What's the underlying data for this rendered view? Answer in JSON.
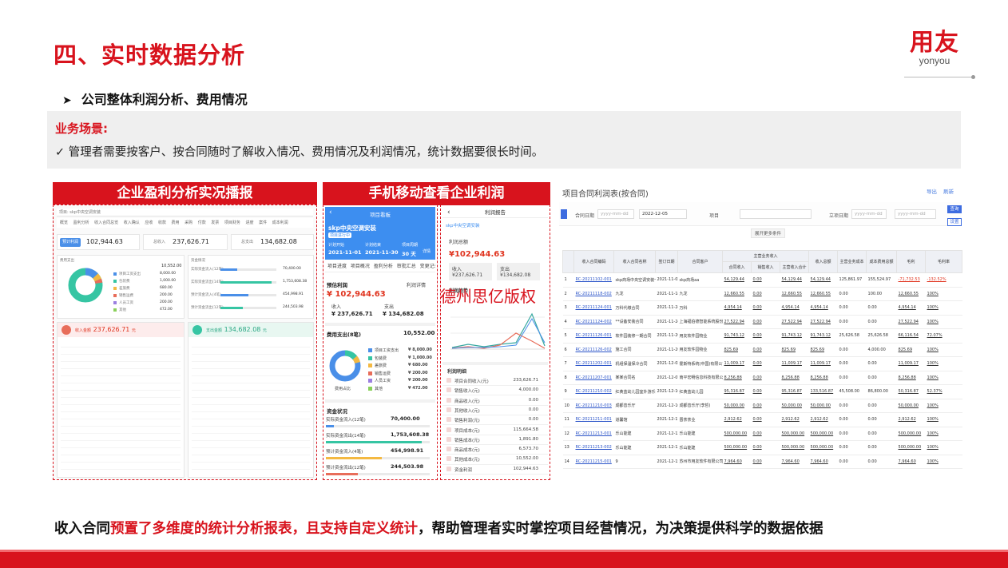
{
  "page": {
    "title": "四、实时数据分析",
    "subtitle": "公司整体利润分析、费用情况",
    "subtitle_bullet": "➤"
  },
  "logo": {
    "cn": "用友",
    "en": "yonyou"
  },
  "scenario": {
    "title": "业务场景:",
    "text": "✓ 管理者需要按客户、按合同随时了解收入情况、费用情况及利润情况，统计数据要很长时间。"
  },
  "panels": {
    "desktop_title": "企业盈利分析实况播报",
    "mobile_title": "手机移动查看企业利润"
  },
  "desktop": {
    "tab_text": "项目: skp中央空调安装",
    "nav_text": "概览 盈利分析 收入合同总览 收入确认 应收 收款 费用 采购 付款 发票 项目财务 进度 案件 成本利润",
    "profit_label": "预计利润",
    "profit_value": "102,944.63",
    "income_label": "总收入",
    "income_value": "237,626.71",
    "expense_label": "总支出",
    "expense_value": "134,682.08",
    "cost_card_title": "费用支出",
    "cost_total": "10,552.00",
    "cost_items": [
      {
        "name": "项目工资支出",
        "value": "8,000.00",
        "color": "#4a8fe8"
      },
      {
        "name": "包装费",
        "value": "1,000.00",
        "color": "#36c5a3"
      },
      {
        "name": "差旅费",
        "value": "680.00",
        "color": "#f4b942"
      },
      {
        "name": "销售运费",
        "value": "200.00",
        "color": "#e86d5a"
      },
      {
        "name": "人员工资",
        "value": "200.00",
        "color": "#9b7fe0"
      },
      {
        "name": "其他",
        "value": "472.00",
        "color": "#8ad05b"
      }
    ],
    "cash_card_title": "资金情况",
    "cash_items": [
      {
        "name": "实际资金流入(12笔)",
        "value": "70,400.00",
        "pct": 0.3,
        "color": "#4a8fe8"
      },
      {
        "name": "实际资金流出(14笔)",
        "value": "1,753,608.38",
        "pct": 0.92,
        "color": "#36c5a3"
      },
      {
        "name": "预计资金流入(4笔)",
        "value": "454,998.91",
        "pct": 0.5,
        "color": "#4a8fe8"
      },
      {
        "name": "预计资金流出(12笔)",
        "value": "244,503.98",
        "pct": 0.4,
        "color": "#36c5a3"
      }
    ],
    "income_card_label": "收入金额",
    "income_card_value": "237,626.71",
    "income_card_unit": "元",
    "expense_card_label": "支出金额",
    "expense_card_value": "134,682.08",
    "expense_card_unit": "元"
  },
  "mobile1": {
    "header": "项目看板",
    "project": "skp中央空调安装",
    "tag": "项目进行中",
    "plan_start_label": "计划开始",
    "plan_start": "2021-11-01",
    "plan_end_label": "计划结束",
    "plan_end": "2021-11-30",
    "cycle_label": "项目周期",
    "cycle": "30 天",
    "detail": "详情",
    "tabs": "项目进度 项目概况 盈利分析 审批汇总 变更记录",
    "profit_title": "预估利润",
    "profit_link": "利润详情",
    "profit": "¥ 102,944.63",
    "income_label": "收入",
    "income": "¥ 237,626.71",
    "expense_label": "支出",
    "expense": "¥ 134,682.08",
    "cost_title": "费用支出(8笔)",
    "cost_total": "10,552.00",
    "donut_center": "费用占比",
    "cost_items": [
      {
        "name": "项目工资支出",
        "value": "¥ 8,000.00",
        "color": "#4a8fe8"
      },
      {
        "name": "包装费",
        "value": "¥ 1,000.00",
        "color": "#36c5a3"
      },
      {
        "name": "差旅费",
        "value": "¥ 680.00",
        "color": "#f4b942"
      },
      {
        "name": "销售运费",
        "value": "¥ 200.00",
        "color": "#e86d5a"
      },
      {
        "name": "人员工资",
        "value": "¥ 200.00",
        "color": "#9b7fe0"
      },
      {
        "name": "其他",
        "value": "¥ 472.00",
        "color": "#8ad05b"
      }
    ],
    "cash_title": "资金状况",
    "cash_items": [
      {
        "name": "实际资金流入(12笔)",
        "value": "70,400.00"
      },
      {
        "name": "实际资金流出(14笔)",
        "value": "1,753,608.38"
      },
      {
        "name": "预计资金流入(4笔)",
        "value": "454,998.91"
      },
      {
        "name": "预计资金流出(12笔)",
        "value": "244,503.98"
      }
    ]
  },
  "mobile2": {
    "header": "利润报告",
    "project": "skp中央空调安装",
    "profit_label": "利润总额",
    "profit": "¥102,944.63",
    "income_label": "收入",
    "income": "¥237,626.71",
    "expense_label": "支出",
    "expense": "¥134,682.08",
    "trend_title": "利润趋势",
    "detail_title": "利润明细",
    "detail_items": [
      {
        "name": "项目合同收入(元)",
        "value": "233,626.71"
      },
      {
        "name": "销售收入(元)",
        "value": "4,000.00"
      },
      {
        "name": "商品收入(元)",
        "value": "0.00"
      },
      {
        "name": "其他收入(元)",
        "value": "0.00"
      },
      {
        "name": "销售利润(元)",
        "value": "0.00"
      },
      {
        "name": "项目成本(元)",
        "value": "115,664.58"
      },
      {
        "name": "销售成本(元)",
        "value": "1,891.80"
      },
      {
        "name": "商品成本(元)",
        "value": "6,573.70"
      },
      {
        "name": "其他成本(元)",
        "value": "10,552.00"
      },
      {
        "name": "资金利润",
        "value": "102,944.63"
      }
    ]
  },
  "watermark": "德州思亿版权",
  "report": {
    "title": "项目合同利润表(按合同)",
    "tools": "导出 刷新",
    "filters": {
      "contract_date": "合同日期",
      "date_from": "yyyy-mm-dd",
      "date_to": "2022-12-05",
      "project": "项目",
      "setup_date": "立项日期",
      "setup_from": "yyyy-mm-dd",
      "setup_to": "yyyy-mm-dd",
      "query": "查询",
      "reset": "设置",
      "more": "展开更多条件"
    },
    "headers": [
      "",
      "收入合同编码",
      "收入合同名称",
      "签订日期",
      "合同客户",
      "合同收入",
      "销售收入",
      "主营收入合计",
      "收入总额",
      "主营业务成本",
      "成本费用总额",
      "毛利",
      "毛利率"
    ],
    "group_header": "主营业务收入",
    "rows": [
      [
        "1",
        "RC-20211102-001",
        "skp商场中央空调安装一...",
        "2021-11-02",
        "skp商场aa",
        "54,129.44",
        "0.00",
        "54,129.44",
        "54,129.44",
        "125,861.97",
        "155,524.97",
        "-71,732.53",
        "-132.52%"
      ],
      [
        "2",
        "RC-20211118-002",
        "九龙",
        "2021-11-18",
        "九龙",
        "12,660.55",
        "0.00",
        "12,660.55",
        "12,660.55",
        "0.00",
        "100.00",
        "12,660.55",
        "100%"
      ],
      [
        "3",
        "RC-20211124-001",
        "万科代缴合同",
        "2021-11-24",
        "万科",
        "4,954.14",
        "0.00",
        "4,954.14",
        "4,954.14",
        "0.00",
        "0.00",
        "4,954.14",
        "100%"
      ],
      [
        "4",
        "RC-20211124-002",
        "**设备安装合同",
        "2021-11-24",
        "上海福伯德智能系统股份有限公司",
        "27,522.94",
        "0.00",
        "27,522.94",
        "27,522.94",
        "0.00",
        "0.00",
        "27,522.94",
        "100%"
      ],
      [
        "5",
        "RC-20211126-001",
        "软件园装修一期合同",
        "2021-11-26",
        "用友软件园物业",
        "91,743.12",
        "0.00",
        "91,743.12",
        "91,743.12",
        "25,626.58",
        "25,626.58",
        "66,116.54",
        "72.07%"
      ],
      [
        "6",
        "RC-20211126-002",
        "施工合同",
        "2021-11-26",
        "用友软件园物业",
        "825.69",
        "0.00",
        "825.69",
        "825.69",
        "0.00",
        "4,000.00",
        "825.69",
        "100%"
      ],
      [
        "7",
        "RC-20211202-001",
        "机组保温保冷合同",
        "2021-12-02",
        "霍斯特系统(中国)有限公司",
        "11,009.17",
        "0.00",
        "11,009.17",
        "11,009.17",
        "0.00",
        "0.00",
        "11,009.17",
        "100%"
      ],
      [
        "8",
        "RC-20211207-001",
        "某某合同名",
        "2021-12-07",
        "南平宏畅信息科技有限公司",
        "8,256.88",
        "0.00",
        "8,256.88",
        "8,256.88",
        "0.00",
        "0.00",
        "8,256.88",
        "100%"
      ],
      [
        "9",
        "RC-20211210-002",
        "红黄蓝幼儿园室外游乐设置",
        "2021-12-10",
        "红黄蓝幼儿园",
        "95,316.87",
        "0.00",
        "95,316.87",
        "133,516.87",
        "45,508.00",
        "86,800.00",
        "50,316.87",
        "52.37%"
      ],
      [
        "10",
        "RC-20211210-003",
        "成都音乐厅",
        "2021-12-10",
        "成都音乐厅(李哲)",
        "50,000.00",
        "0.00",
        "50,000.00",
        "50,000.00",
        "0.00",
        "0.00",
        "50,000.00",
        "100%"
      ],
      [
        "11",
        "RC-20211211-001",
        "道馨馆",
        "2021-12-11",
        "晋茶茶业",
        "2,912.62",
        "0.00",
        "2,912.62",
        "2,912.62",
        "0.00",
        "0.00",
        "2,912.62",
        "100%"
      ],
      [
        "12",
        "RC-20211213-001",
        "乐山能建",
        "2021-12-13",
        "乐山能建",
        "500,000.00",
        "0.00",
        "500,000.00",
        "500,000.00",
        "0.00",
        "0.00",
        "500,000.00",
        "100%"
      ],
      [
        "13",
        "RC-20211213-002",
        "乐山能建",
        "2021-12-13",
        "乐山能建",
        "500,000.00",
        "0.00",
        "500,000.00",
        "500,000.00",
        "0.00",
        "0.00",
        "500,000.00",
        "100%"
      ],
      [
        "14",
        "RC-20211215-001",
        "9",
        "2021-12-15",
        "苏州市用友软件有限公司黄山用...",
        "7,964.60",
        "0.00",
        "7,964.60",
        "7,964.60",
        "0.00",
        "0.00",
        "7,964.60",
        "100%"
      ]
    ]
  },
  "conclusion": {
    "part1": "收入合同",
    "part2": "预置了多维度的统计分析报表，且支持自定义统计",
    "part3": "，帮助管理者实时掌控项目经营情况，为决策提供科学的数据依据"
  },
  "colors": {
    "brand_red": "#d8131d",
    "blue": "#3d8ef0",
    "profit_red": "#e0341f"
  }
}
